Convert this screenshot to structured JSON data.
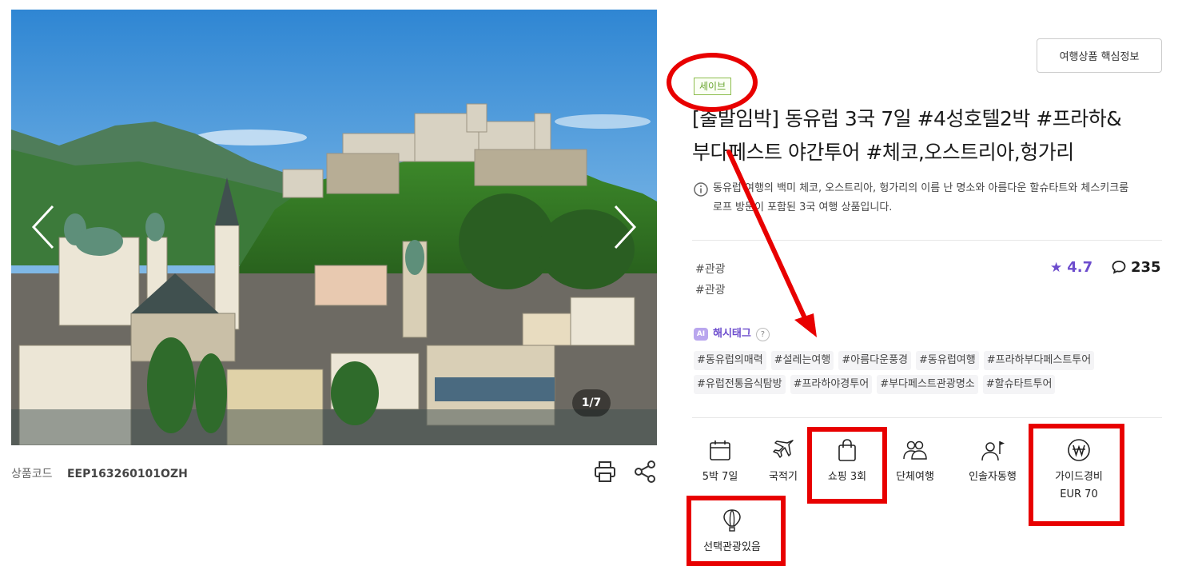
{
  "gallery": {
    "counter": "1/7"
  },
  "product": {
    "code_label": "상품코드",
    "code_value": "EEP163260101OZH",
    "key_info_button": "여행상품 핵심정보",
    "badge": "세이브",
    "title_line1": "[출발임박] 동유럽 3국 7일 #4성호텔2박 #프라하&",
    "title_line2": "부다페스트 야간투어 #체코,오스트리아,헝가리",
    "description_line1": "동유럽 여행의 백미 체코, 오스트리아, 헝가리의 이름 난 명소와 아름다운 할슈타트와 체스키크룸",
    "description_line2": "로프 방문이 포함된 3국 여행 상품입니다.",
    "tags": [
      "#관광",
      "#관광"
    ],
    "rating": "4.7",
    "review_count": "235"
  },
  "hashtags": {
    "ai_label": "AI",
    "title": "해시태그",
    "help": "?",
    "row1": [
      "#동유럽의매력",
      "#설레는여행",
      "#아름다운풍경",
      "#동유럽여행",
      "#프라하부다페스트투어"
    ],
    "row2": [
      "#유럽전통음식탐방",
      "#프라하야경투어",
      "#부다페스트관광명소",
      "#할슈타트투어"
    ]
  },
  "features": {
    "duration": "5박 7일",
    "airline": "국적기",
    "shopping": "쇼핑 3회",
    "group": "단체여행",
    "guide": "인솔자동행",
    "guide_fee_label": "가이드경비",
    "guide_fee_value": "EUR 70",
    "optional_tour": "선택관광있음"
  },
  "colors": {
    "accent": "#6c4ccd",
    "annotation": "#e80000",
    "badge": "#6aa530"
  },
  "icons": [
    "chevron-left-icon",
    "chevron-right-icon",
    "printer-icon",
    "share-icon",
    "info-icon",
    "star-icon",
    "speech-bubble-icon",
    "calendar-icon",
    "airplane-icon",
    "shopping-bag-icon",
    "group-icon",
    "tour-guide-icon",
    "won-coin-icon",
    "hot-air-balloon-icon"
  ]
}
